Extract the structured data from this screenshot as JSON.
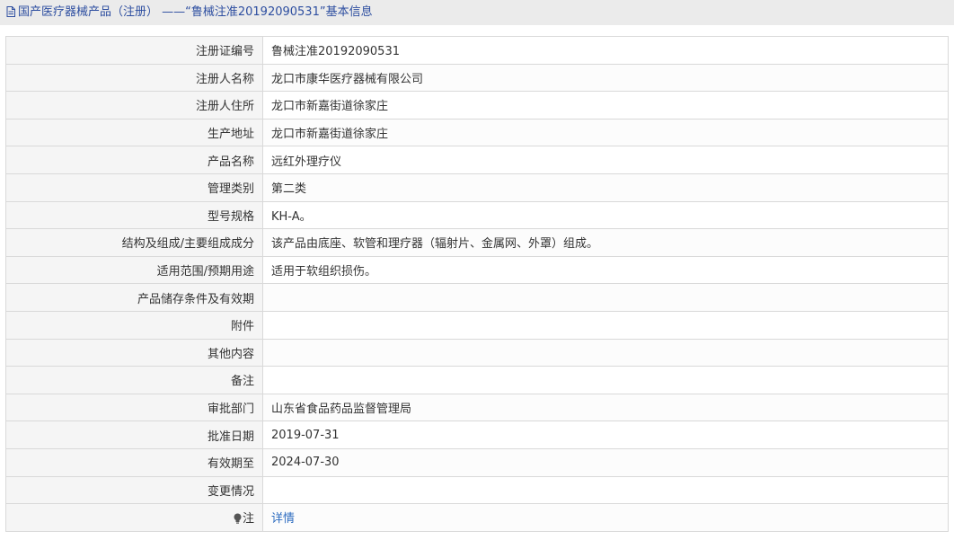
{
  "header": {
    "title": "国产医疗器械产品（注册） ——“鲁械注准20192090531”基本信息",
    "icon": "document-icon"
  },
  "fields": [
    {
      "label": "注册证编号",
      "value": "鲁械注准20192090531"
    },
    {
      "label": "注册人名称",
      "value": "龙口市康华医疗器械有限公司"
    },
    {
      "label": "注册人住所",
      "value": "龙口市新嘉街道徐家庄"
    },
    {
      "label": "生产地址",
      "value": "龙口市新嘉街道徐家庄"
    },
    {
      "label": "产品名称",
      "value": "远红外理疗仪"
    },
    {
      "label": "管理类别",
      "value": "第二类"
    },
    {
      "label": "型号规格",
      "value": "KH-A。"
    },
    {
      "label": "结构及组成/主要组成成分",
      "value": "该产品由底座、软管和理疗器（辐射片、金属网、外罩）组成。"
    },
    {
      "label": "适用范围/预期用途",
      "value": "适用于软组织损伤。"
    },
    {
      "label": "产品储存条件及有效期",
      "value": ""
    },
    {
      "label": "附件",
      "value": ""
    },
    {
      "label": "其他内容",
      "value": ""
    },
    {
      "label": "备注",
      "value": ""
    },
    {
      "label": "审批部门",
      "value": "山东省食品药品监督管理局"
    },
    {
      "label": "批准日期",
      "value": "2019-07-31"
    },
    {
      "label": "有效期至",
      "value": "2024-07-30"
    },
    {
      "label": "变更情况",
      "value": ""
    }
  ],
  "note": {
    "label": "注",
    "icon": "lightbulb-icon",
    "link_text": "详情"
  },
  "colors": {
    "title_text": "#2d4ea0",
    "link": "#2d6cc0",
    "label_bg": "#f5f5f5",
    "border": "#d9d9d9"
  }
}
